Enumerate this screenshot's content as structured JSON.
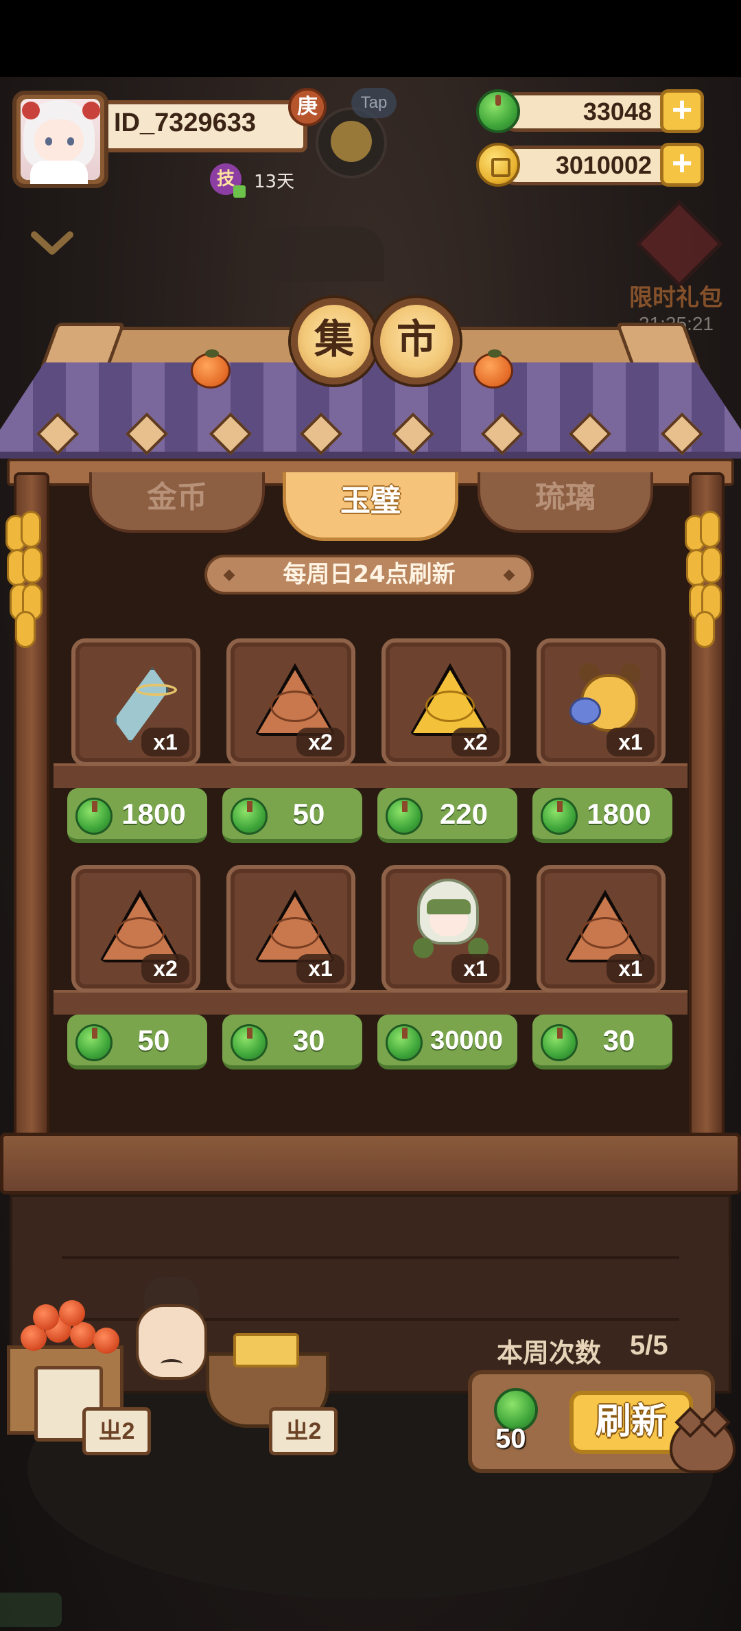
{
  "player": {
    "id": "ID_7329633",
    "tag": "庚",
    "tap_hint": "Tap",
    "skill_label": "技",
    "days": "13天"
  },
  "currencies": {
    "jade": "33048",
    "coins": "3010002",
    "add_symbol": "+"
  },
  "gift": {
    "label": "限时礼包",
    "timer": "21:25:21"
  },
  "market": {
    "title_chars": [
      "集",
      "市"
    ],
    "tabs": [
      {
        "label": "金币",
        "active": false
      },
      {
        "label": "玉璧",
        "active": true
      },
      {
        "label": "琉璃",
        "active": false
      }
    ],
    "refresh_notice": "每周日24点刷新"
  },
  "items": [
    {
      "icon": "umbrella-item-icon",
      "count": "x1",
      "price": "1800"
    },
    {
      "icon": "brown-triangle-rune-icon",
      "count": "x2",
      "price": "50"
    },
    {
      "icon": "gold-triangle-rune-icon",
      "count": "x2",
      "price": "220"
    },
    {
      "icon": "dog-character-icon",
      "count": "x1",
      "price": "1800"
    },
    {
      "icon": "brown-triangle-rune-icon",
      "count": "x2",
      "price": "50"
    },
    {
      "icon": "brown-triangle-sun-rune-icon",
      "count": "x1",
      "price": "30"
    },
    {
      "icon": "hooded-girl-character-icon",
      "count": "x1",
      "price": "30000"
    },
    {
      "icon": "brown-triangle-rune-icon",
      "count": "x1",
      "price": "30"
    }
  ],
  "vendor": {
    "sign_left": "ㄓ2",
    "sign_right": "ㄓ2"
  },
  "refresh": {
    "weekly_label": "本周次数",
    "weekly_value": "5/5",
    "cost": "50",
    "button_label": "刷新"
  },
  "colors": {
    "price_green": "#7aa54d",
    "active_tab": "#f5c47a",
    "wood": "#6d4330"
  }
}
